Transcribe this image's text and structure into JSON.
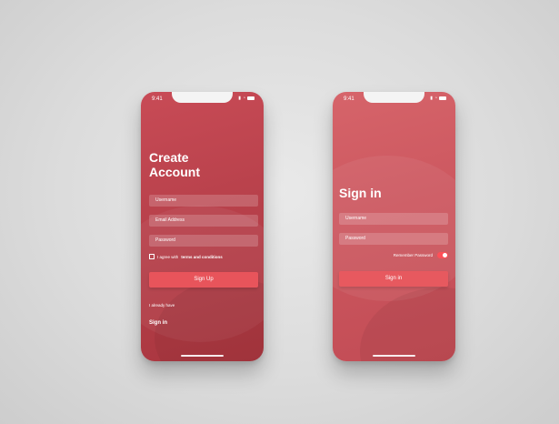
{
  "colors": {
    "background": "#dcdcdc",
    "left_phone": "#b8414b",
    "right_phone": "#cc575f",
    "button": "#e8545b",
    "toggle": "#ff4f58"
  },
  "left_screen": {
    "time": "9:41",
    "title_line1": "Create",
    "title_line2": "Account",
    "username_placeholder": "Username",
    "email_placeholder": "Email Address",
    "password_placeholder": "Password",
    "terms_prefix": "I agree with",
    "terms_link": "terms and conditions",
    "button_label": "Sign Up",
    "already_text": "I already have",
    "signin_link": "Sign in"
  },
  "right_screen": {
    "time": "9:41",
    "title": "Sign in",
    "username_placeholder": "Username",
    "password_placeholder": "Password",
    "remember_label": "Remember Password",
    "button_label": "Sign in"
  }
}
